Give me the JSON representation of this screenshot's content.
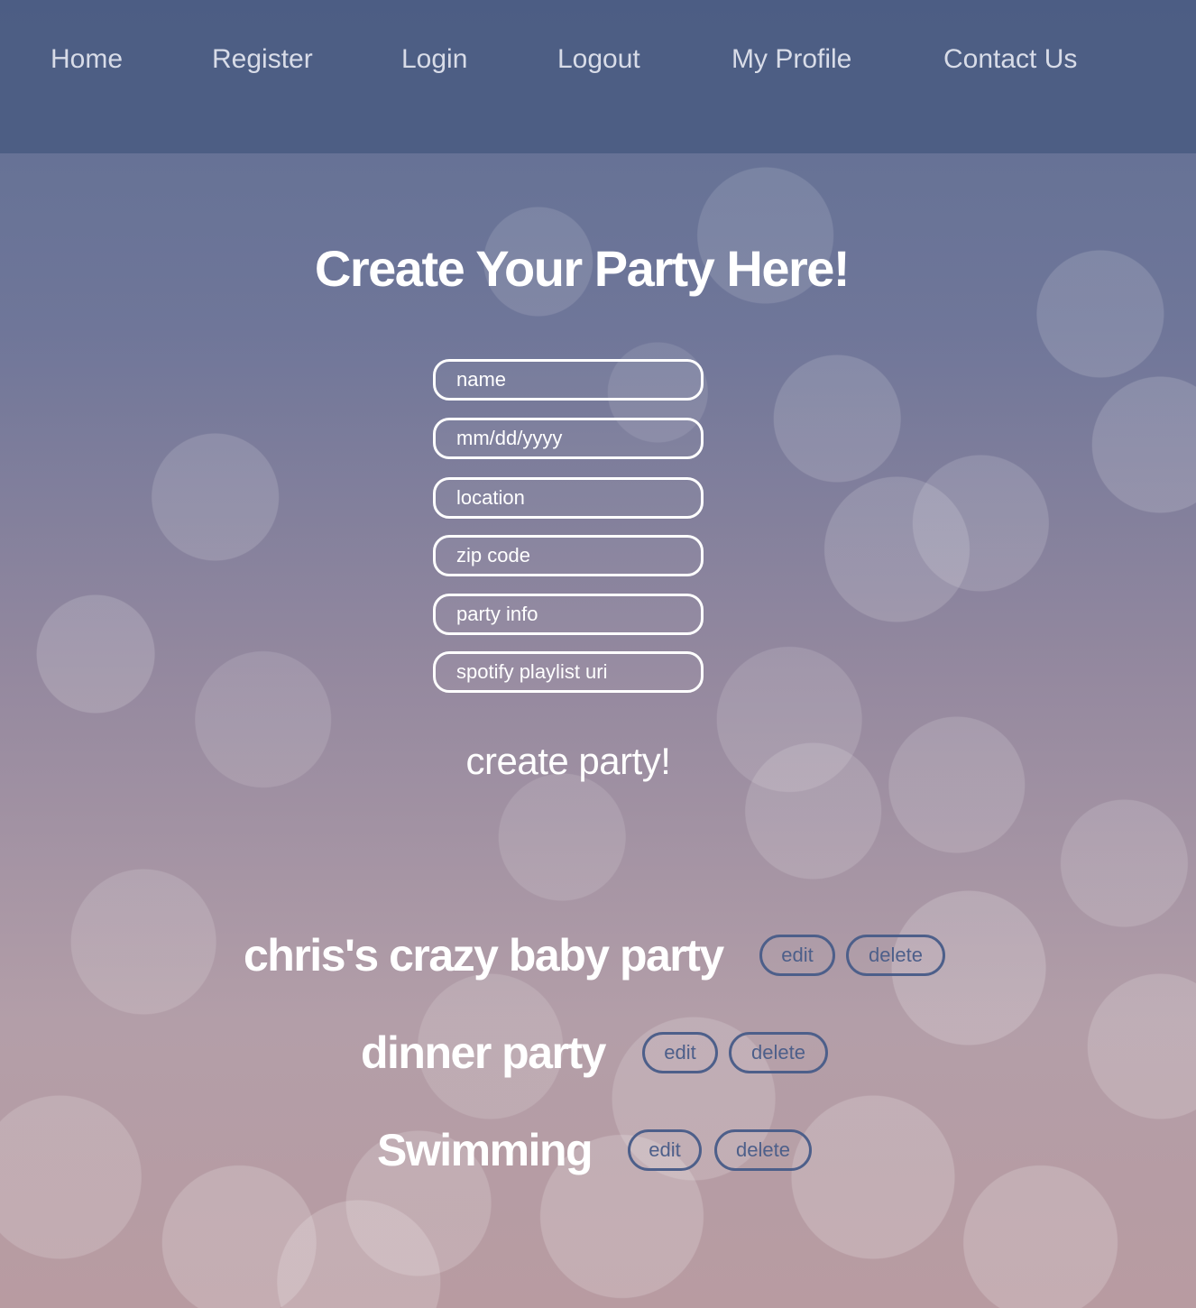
{
  "nav": {
    "home": "Home",
    "register": "Register",
    "login": "Login",
    "logout": "Logout",
    "my_profile": "My Profile",
    "contact_us": "Contact Us"
  },
  "page_title": "Create Your Party Here!",
  "form": {
    "name_placeholder": "name",
    "date_placeholder": "mm/dd/yyyy",
    "location_placeholder": "location",
    "zip_placeholder": "zip code",
    "info_placeholder": "party info",
    "playlist_placeholder": "spotify playlist uri",
    "submit_label": "create party!"
  },
  "parties": [
    {
      "name": "chris's crazy baby party",
      "edit_label": "edit",
      "delete_label": "delete"
    },
    {
      "name": "dinner party",
      "edit_label": "edit",
      "delete_label": "delete"
    },
    {
      "name": "Swimming",
      "edit_label": "edit",
      "delete_label": "delete"
    }
  ],
  "colors": {
    "nav_background": "#4a5b82",
    "button_outline": "#4d5f8a",
    "text_primary": "#ffffff"
  }
}
